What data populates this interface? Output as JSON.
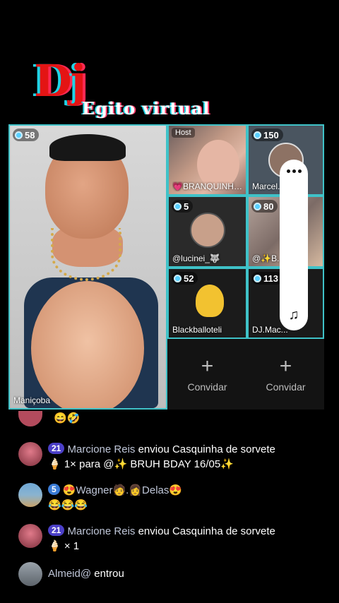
{
  "logo": {
    "line1": "Dj",
    "line2": "Egito virtual"
  },
  "host_tile": {
    "seat": "58",
    "name": "Maniçoba"
  },
  "tiles": [
    {
      "badge": "Host",
      "name": "💗BRANQUINHA..."
    },
    {
      "seat": "150",
      "name": "Marcel..."
    },
    {
      "seat": "5",
      "name": "@lucinei_🐺"
    },
    {
      "seat": "80",
      "name": "@✨B..."
    },
    {
      "seat": "52",
      "name": "Blackballoteli"
    },
    {
      "seat": "113",
      "name": "DJ.Mac..."
    }
  ],
  "invite": {
    "plus": "+",
    "label": "Convidar"
  },
  "chat": {
    "partial_emojis": "😄🤣",
    "messages": [
      {
        "level": "21",
        "user": "Marcione Reis",
        "action": "enviou Casquinha de sorvete",
        "line2": "🍦 1× para @✨ BRUH BDAY 16/05✨"
      },
      {
        "level": "5",
        "user": "😍Wagner🧑.👩Delas😍",
        "line2": "😂😂😂"
      },
      {
        "level": "21",
        "user": "Marcione Reis",
        "action": "enviou Casquinha de sorvete",
        "line2": "🍦 × 1"
      },
      {
        "user": "Almeid@",
        "action": "entrou"
      }
    ]
  },
  "icons": {
    "menu": "more-dots-icon",
    "music": "music-note-icon",
    "seat": "seat-dot-icon"
  }
}
